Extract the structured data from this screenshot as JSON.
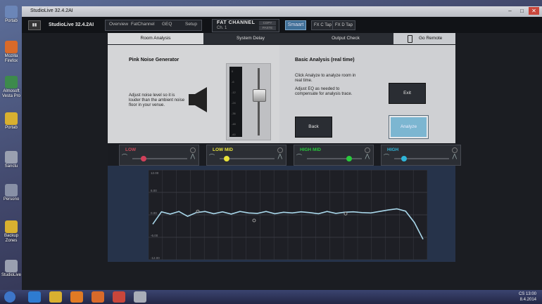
{
  "desktop": {
    "icons": [
      {
        "label": "Portab",
        "color": "#6b86b8"
      },
      {
        "label": "Mozilla Firefox",
        "color": "#d86a2a"
      },
      {
        "label": "Almosoft Vesta Pro",
        "color": "#3d8a4c"
      },
      {
        "label": "Portab",
        "color": "#d8b030"
      },
      {
        "label": "Sanctu",
        "color": "#9aa0b0"
      },
      {
        "label": "Persono",
        "color": "#8890a6"
      },
      {
        "label": "Backup Zones",
        "color": "#d8b030"
      },
      {
        "label": "StudioLive",
        "color": "#9aa0b0"
      }
    ]
  },
  "window": {
    "title": "StudioLive 32.4.2AI",
    "controls": {
      "minimize": "–",
      "maximize": "□",
      "close": "✕"
    }
  },
  "app": {
    "device_name": "StudioLive 32.4.2AI",
    "nav": [
      "Overview",
      "FatChannel",
      "GEQ",
      "Setup"
    ],
    "fat_channel": {
      "title": "FAT CHANNEL",
      "channel": "Ch. 1",
      "copy": "COPY",
      "paste": "PASTE"
    },
    "smaart_label": "Smaart",
    "fx_taps": [
      "FX C Tap",
      "FX D Tap"
    ]
  },
  "tabs": {
    "items": [
      "Room Analysis",
      "System Delay",
      "Output Check"
    ],
    "active_index": 0,
    "go_remote": "Go Remote"
  },
  "left_panel": {
    "title": "Pink Noise Generator",
    "instruction": "Adjust noise level so it is louder than the ambient noise floor in your venue.",
    "meter_ticks": [
      "0",
      "-6",
      "-12",
      "-24",
      "-36",
      "-48",
      "-60"
    ],
    "fader_level": 0.6
  },
  "right_panel": {
    "title": "Basic Analysis (real time)",
    "text1": "Click Analyze to analyze room in real time.",
    "text2": "Adjust EQ as needed to compensate for analysis trace.",
    "exit_label": "Exit",
    "back_label": "Back",
    "analyze_label": "Analyze"
  },
  "eq_bands": [
    {
      "name": "LOW",
      "color": "#d0405a",
      "text_color": "#c84a5a"
    },
    {
      "name": "LOW MID",
      "color": "#e8e23a",
      "text_color": "#e8e23a"
    },
    {
      "name": "HIGH MID",
      "color": "#29c93c",
      "text_color": "#29c93c"
    },
    {
      "name": "HIGH",
      "color": "#2fb5d8",
      "text_color": "#2fb5d8"
    }
  ],
  "graph": {
    "y_labels": [
      "12.00",
      "6.00",
      "0.00",
      "-6.00",
      "-12.00"
    ],
    "trace_color": "#a9d7ea",
    "trace": [
      -2.5,
      0.8,
      0.2,
      0.9,
      -0.4,
      0.6,
      0.9,
      0.3,
      0.8,
      0.2,
      0.9,
      0.5,
      0.4,
      0.9,
      0.3,
      0.7,
      0.5,
      0.8,
      0.6,
      0.3,
      0.9,
      0.4,
      0.7,
      0.8,
      0.6,
      0.5,
      0.9,
      1.3,
      1.6,
      1.0,
      -2.0,
      -6.5
    ]
  },
  "taskbar": {
    "apps": [
      {
        "name": "start-orb",
        "color": "#3d76c9"
      },
      {
        "name": "internet-explorer",
        "color": "#2e7bd1"
      },
      {
        "name": "file-explorer",
        "color": "#d8b030"
      },
      {
        "name": "media-player",
        "color": "#e07a24"
      },
      {
        "name": "firefox",
        "color": "#d86a2a"
      },
      {
        "name": "chrome",
        "color": "#c9463b"
      },
      {
        "name": "studiolive",
        "color": "#a8adb8"
      }
    ],
    "language": "CS",
    "time": "13:00",
    "date": "8.4.2014"
  }
}
